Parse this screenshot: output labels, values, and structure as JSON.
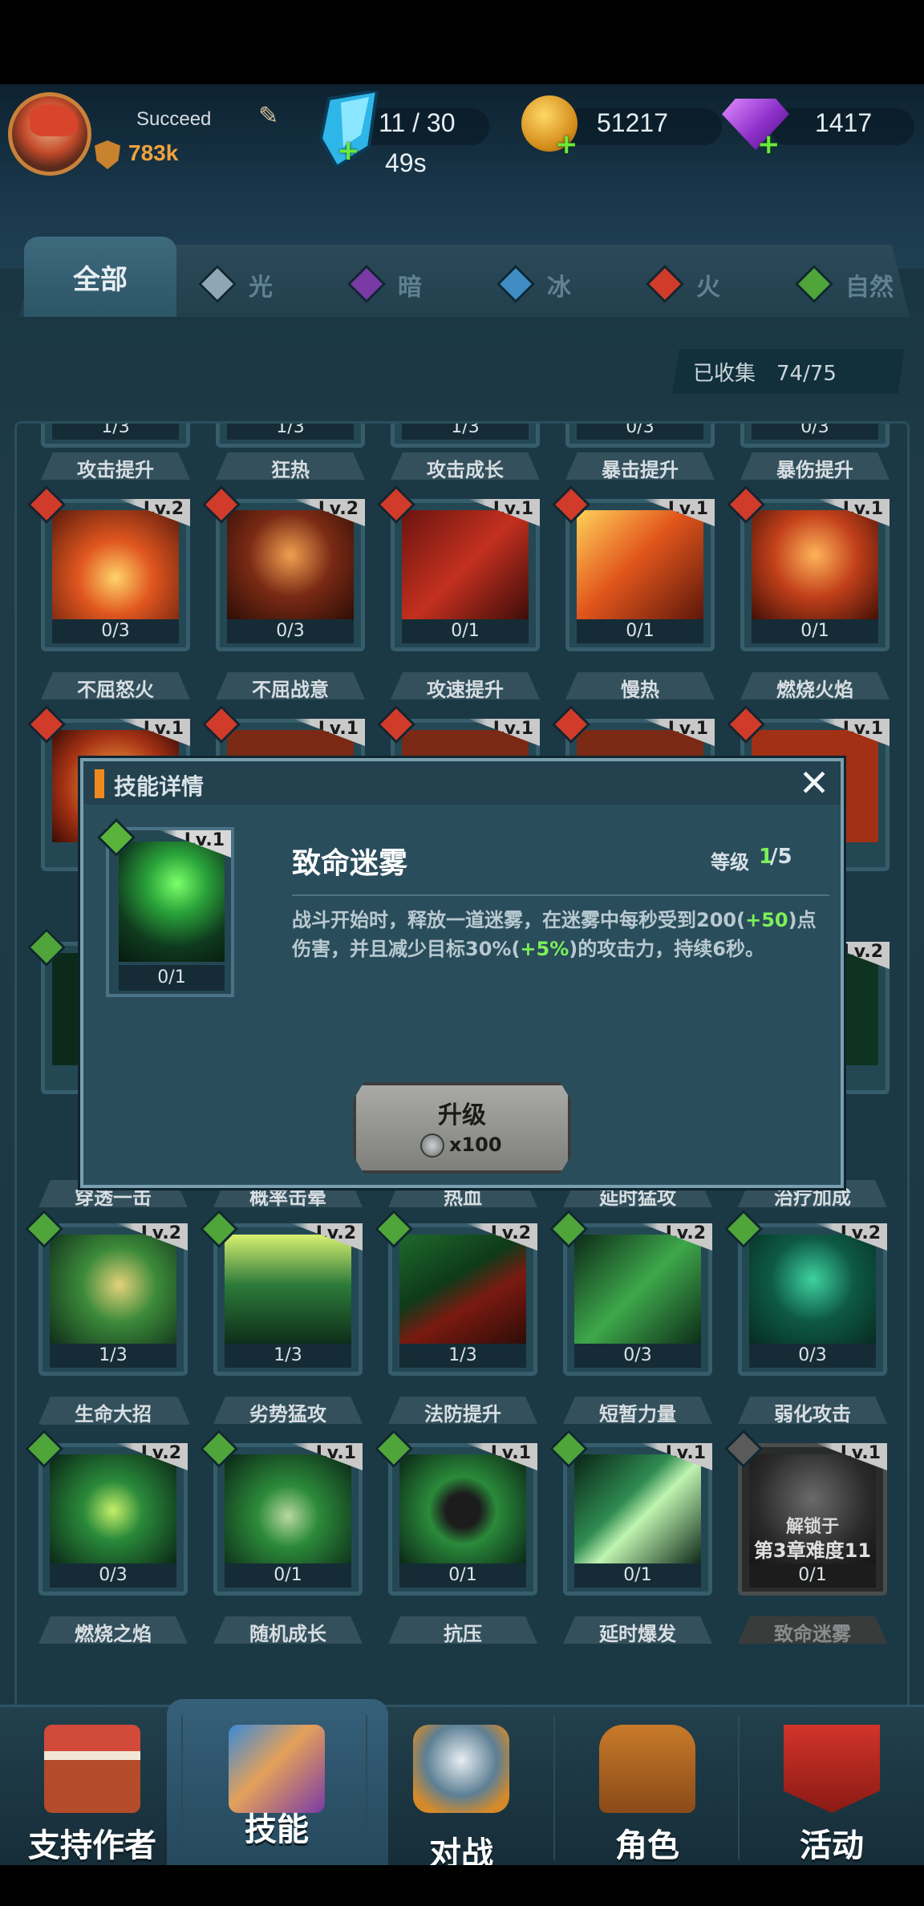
{
  "player": {
    "name": "Succeed",
    "power": "783k"
  },
  "resources": {
    "energy": "11 / 30",
    "energy_timer": "49s",
    "gold": "51217",
    "gems": "1417"
  },
  "tabs": [
    {
      "label": "全部",
      "color": "#ffffff"
    },
    {
      "label": "光",
      "color": "#8fa7b4"
    },
    {
      "label": "暗",
      "color": "#7a3aa5"
    },
    {
      "label": "冰",
      "color": "#3e8cc2"
    },
    {
      "label": "火",
      "color": "#d13b2a"
    },
    {
      "label": "自然",
      "color": "#4fa43a"
    }
  ],
  "collected": "已收集　74/75",
  "row0": [
    "1/3",
    "1/3",
    "1/3",
    "0/3",
    "0/3"
  ],
  "row0_labels": [
    "攻击提升",
    "狂热",
    "攻击成长",
    "暴击提升",
    "暴伤提升"
  ],
  "row1": [
    {
      "lv": "Lv.2",
      "count": "0/3",
      "name": "不屈怒火"
    },
    {
      "lv": "Lv.2",
      "count": "0/3",
      "name": "不屈战意"
    },
    {
      "lv": "Lv.1",
      "count": "0/1",
      "name": "攻速提升"
    },
    {
      "lv": "Lv.1",
      "count": "0/1",
      "name": "慢热"
    },
    {
      "lv": "Lv.1",
      "count": "0/1",
      "name": "燃烧火焰"
    }
  ],
  "row2_lv": [
    "Lv.1",
    "Lv.1",
    "Lv.1",
    "Lv.1",
    "Lv.1"
  ],
  "row3_lv_last": "Lv.2",
  "row3_labels": [
    "穿透一击",
    "概率击晕",
    "热血",
    "延时猛攻",
    "治疗加成"
  ],
  "row4": [
    {
      "lv": "Lv.2",
      "count": "1/3",
      "name": "生命大招"
    },
    {
      "lv": "Lv.2",
      "count": "1/3",
      "name": "劣势猛攻"
    },
    {
      "lv": "Lv.2",
      "count": "1/3",
      "name": "法防提升"
    },
    {
      "lv": "Lv.2",
      "count": "0/3",
      "name": "短暂力量"
    },
    {
      "lv": "Lv.2",
      "count": "0/3",
      "name": "弱化攻击"
    }
  ],
  "row5": [
    {
      "lv": "Lv.2",
      "count": "0/3",
      "name": "燃烧之焰"
    },
    {
      "lv": "Lv.1",
      "count": "0/1",
      "name": "随机成长"
    },
    {
      "lv": "Lv.1",
      "count": "0/1",
      "name": "抗压"
    },
    {
      "lv": "Lv.1",
      "count": "0/1",
      "name": "延时爆发"
    },
    {
      "lv": "Lv.1",
      "count": "0/1",
      "name": "致命迷雾"
    }
  ],
  "locked_line1": "解锁于",
  "locked_line2": "第3章难度11",
  "dialog": {
    "title": "技能详情",
    "close": "✕",
    "card_lv": "Lv.1",
    "card_count": "0/1",
    "skill_name": "致命迷雾",
    "level_label": "等级",
    "level_cur": "1",
    "level_max": "/5",
    "desc_1": "战斗开始时，释放一道迷雾，在迷雾中每秒受到200(",
    "desc_hl1": "+50",
    "desc_2": ")点伤害，并且减少目标30%(",
    "desc_hl2": "+5%",
    "desc_3": ")的攻击力，持续6秒。",
    "upgrade_label": "升级",
    "upgrade_cost": "x100"
  },
  "nav": [
    {
      "label": "支持作者"
    },
    {
      "label": "技能"
    },
    {
      "label": "对战"
    },
    {
      "label": "角色"
    },
    {
      "label": "活动"
    }
  ]
}
